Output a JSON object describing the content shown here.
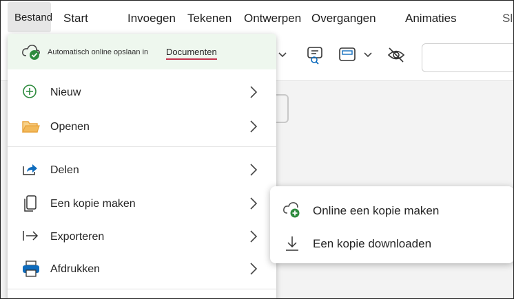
{
  "tabs": {
    "active": "Bestand",
    "items": [
      "Start",
      "Invoegen",
      "Tekenen",
      "Ontwerpen",
      "Overgangen",
      "Animaties",
      "Sl"
    ]
  },
  "file_menu": {
    "autosave_text": "Automatisch online opslaan in",
    "autosave_location": "Documenten",
    "items": [
      {
        "label": "Nieuw",
        "icon": "plus-circle-icon"
      },
      {
        "label": "Openen",
        "icon": "folder-icon"
      },
      {
        "label": "Delen",
        "icon": "share-icon"
      },
      {
        "label": "Een kopie maken",
        "icon": "copy-icon"
      },
      {
        "label": "Exporteren",
        "icon": "export-arrow-icon"
      },
      {
        "label": "Afdrukken",
        "icon": "printer-icon"
      }
    ]
  },
  "submenu": {
    "items": [
      {
        "label": "Online een kopie maken",
        "icon": "cloud-add-icon"
      },
      {
        "label": "Een kopie downloaden",
        "icon": "download-icon"
      }
    ]
  },
  "colors": {
    "accent_green": "#2e8b3e",
    "folder_orange": "#e8a23a",
    "share_blue": "#0f6cbd",
    "link_underline": "#c4314b",
    "banner_bg": "#eef7ee"
  }
}
